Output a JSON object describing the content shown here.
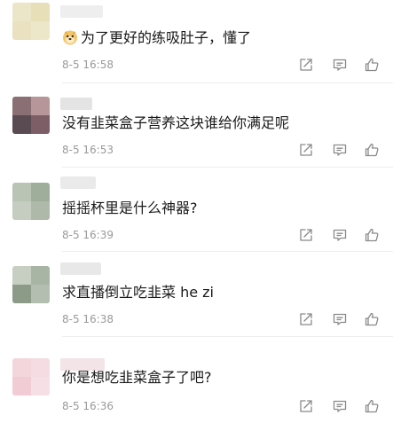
{
  "comments": [
    {
      "text": "为了更好的练吸肚子，懂了",
      "time": "8-5 16:58",
      "emoji": "doge-emoji-icon",
      "avatar_colors": [
        "#ece6c8",
        "#e7dfb8",
        "#e9e1c0",
        "#ede7c9"
      ],
      "name_blur_color": "#eeeeee"
    },
    {
      "text": "没有韭菜盒子营养这块谁给你满足呢",
      "time": "8-5 16:53",
      "avatar_colors": [
        "#8a7074",
        "#b69698",
        "#5a4a52",
        "#7e5e66"
      ],
      "name_blur_color": "#e4e4e4"
    },
    {
      "text": "摇摇杯里是什么神器?",
      "time": "8-5 16:39",
      "avatar_colors": [
        "#b9c4b4",
        "#9fae9b",
        "#c4cdc0",
        "#aeb9a9"
      ],
      "name_blur_color": "#eaeaea"
    },
    {
      "text": "求直播倒立吃韭菜 he zi",
      "time": "8-5 16:38",
      "avatar_colors": [
        "#c7cfc3",
        "#a9b5a4",
        "#8c9b87",
        "#b3bdb0"
      ],
      "name_blur_color": "#e8e8e8"
    },
    {
      "text": "你是想吃韭菜盒子了吧?",
      "time": "8-5 16:36",
      "avatar_colors": [
        "#f3d6dc",
        "#f5dce2",
        "#f1ccd5",
        "#f6e0e5"
      ],
      "name_blur_color": "#f2e4e7"
    }
  ],
  "action_icons": [
    "share-icon",
    "reply-icon",
    "like-icon"
  ],
  "colors": {
    "text": "#1a1a1a",
    "time": "#9a9a9a",
    "icon": "#8a8a8a",
    "divider": "#ededed"
  }
}
